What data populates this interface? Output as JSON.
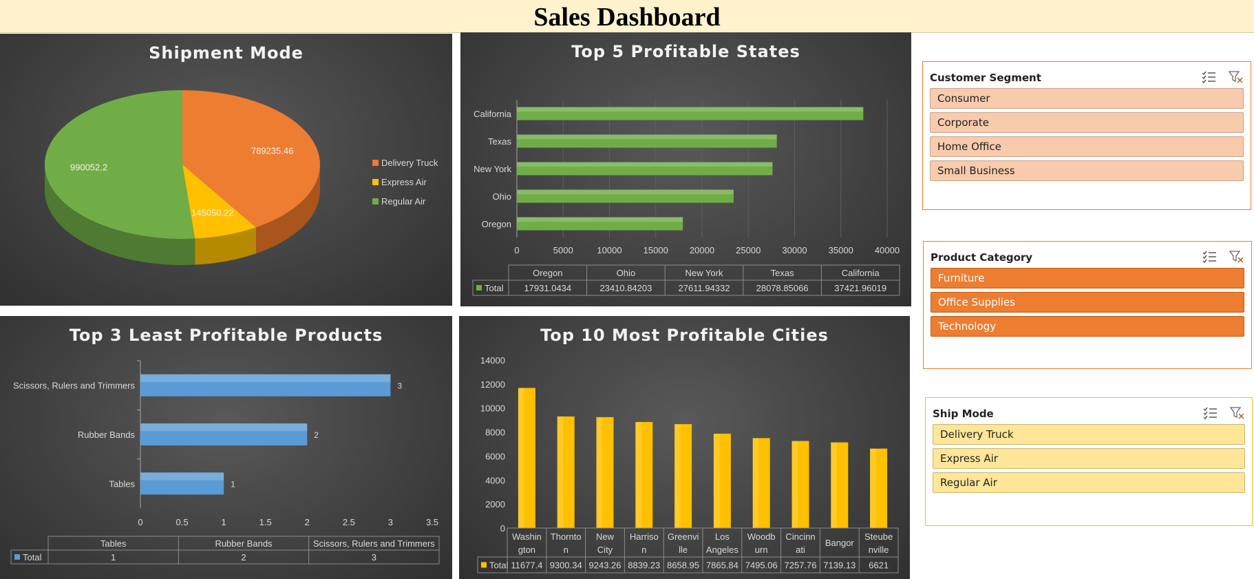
{
  "dashboard": {
    "title": "Sales Dashboard"
  },
  "colors": {
    "delivery_truck": "#ed7d31",
    "express_air": "#ffc000",
    "regular_air": "#70ad47",
    "states_bar": "#70ad47",
    "products_bar": "#5b9bd5",
    "cities_bar": "#ffc000"
  },
  "chart_data": [
    {
      "type": "pie",
      "title": "Shipment Mode",
      "categories": [
        "Delivery Truck",
        "Express Air",
        "Regular Air"
      ],
      "values": [
        789235.46,
        145050.22,
        990052.2
      ],
      "data_labels": [
        "789235.46",
        "145050.22",
        "990052.2"
      ],
      "legend": "right"
    },
    {
      "type": "bar",
      "title": "Top 5 Profitable States",
      "orientation": "horizontal",
      "categories": [
        "Oregon",
        "Ohio",
        "New York",
        "Texas",
        "California"
      ],
      "series": [
        {
          "name": "Total",
          "values": [
            17931.0434,
            23410.84203,
            27611.94332,
            28078.85066,
            37421.96019
          ]
        }
      ],
      "table_values": [
        "17931.0434",
        "23410.84203",
        "27611.94332",
        "28078.85066",
        "37421.96019"
      ],
      "xlim": [
        0,
        40000
      ],
      "xticks": [
        "0",
        "5000",
        "10000",
        "15000",
        "20000",
        "25000",
        "30000",
        "35000",
        "40000"
      ],
      "grid": true,
      "data_table": true
    },
    {
      "type": "bar",
      "title": "Top 3 Least Profitable Products",
      "orientation": "horizontal",
      "categories": [
        "Tables",
        "Rubber Bands",
        "Scissors, Rulers and Trimmers"
      ],
      "series": [
        {
          "name": "Total",
          "values": [
            1,
            2,
            3
          ]
        }
      ],
      "table_values": [
        "1",
        "2",
        "3"
      ],
      "xlim": [
        0,
        3.5
      ],
      "xticks": [
        "0",
        "0.5",
        "1",
        "1.5",
        "2",
        "2.5",
        "3",
        "3.5"
      ],
      "grid": false,
      "data_table": true
    },
    {
      "type": "bar",
      "title": "Top 10 Most Profitable Cities",
      "orientation": "vertical",
      "categories": [
        "Washington",
        "Thornton",
        "New City",
        "Harrison",
        "Greenville",
        "Los Angeles",
        "Woodburn",
        "Cincinnati",
        "Bangor",
        "Steubenville"
      ],
      "category_display": [
        [
          "Washin",
          "gton"
        ],
        [
          "Thornto",
          "n"
        ],
        [
          "New",
          "City"
        ],
        [
          "Harriso",
          "n"
        ],
        [
          "Greenvi",
          "lle"
        ],
        [
          "Los",
          "Angeles"
        ],
        [
          "Woodb",
          "urn"
        ],
        [
          "Cincinn",
          "ati"
        ],
        [
          "Bangor"
        ],
        [
          "Steube",
          "nville"
        ]
      ],
      "series": [
        {
          "name": "Total",
          "values": [
            11677.4,
            9300.34,
            9243.26,
            8839.23,
            8658.95,
            7865.84,
            7495.06,
            7257.76,
            7139.13,
            6621
          ]
        }
      ],
      "table_values": [
        "11677.4",
        "9300.34",
        "9243.26",
        "8839.23",
        "8658.95",
        "7865.84",
        "7495.06",
        "7257.76",
        "7139.13",
        "6621"
      ],
      "ylim": [
        0,
        14000
      ],
      "yticks": [
        "0",
        "2000",
        "4000",
        "6000",
        "8000",
        "10000",
        "12000",
        "14000"
      ],
      "grid": false,
      "data_table": true
    }
  ],
  "slicers": {
    "segment": {
      "title": "Customer Segment",
      "items": [
        "Consumer",
        "Corporate",
        "Home Office",
        "Small Business"
      ]
    },
    "category": {
      "title": "Product Category",
      "items": [
        "Furniture",
        "Office Supplies",
        "Technology"
      ]
    },
    "shipmode": {
      "title": "Ship Mode",
      "items": [
        "Delivery Truck",
        "Express Air",
        "Regular Air"
      ]
    }
  }
}
